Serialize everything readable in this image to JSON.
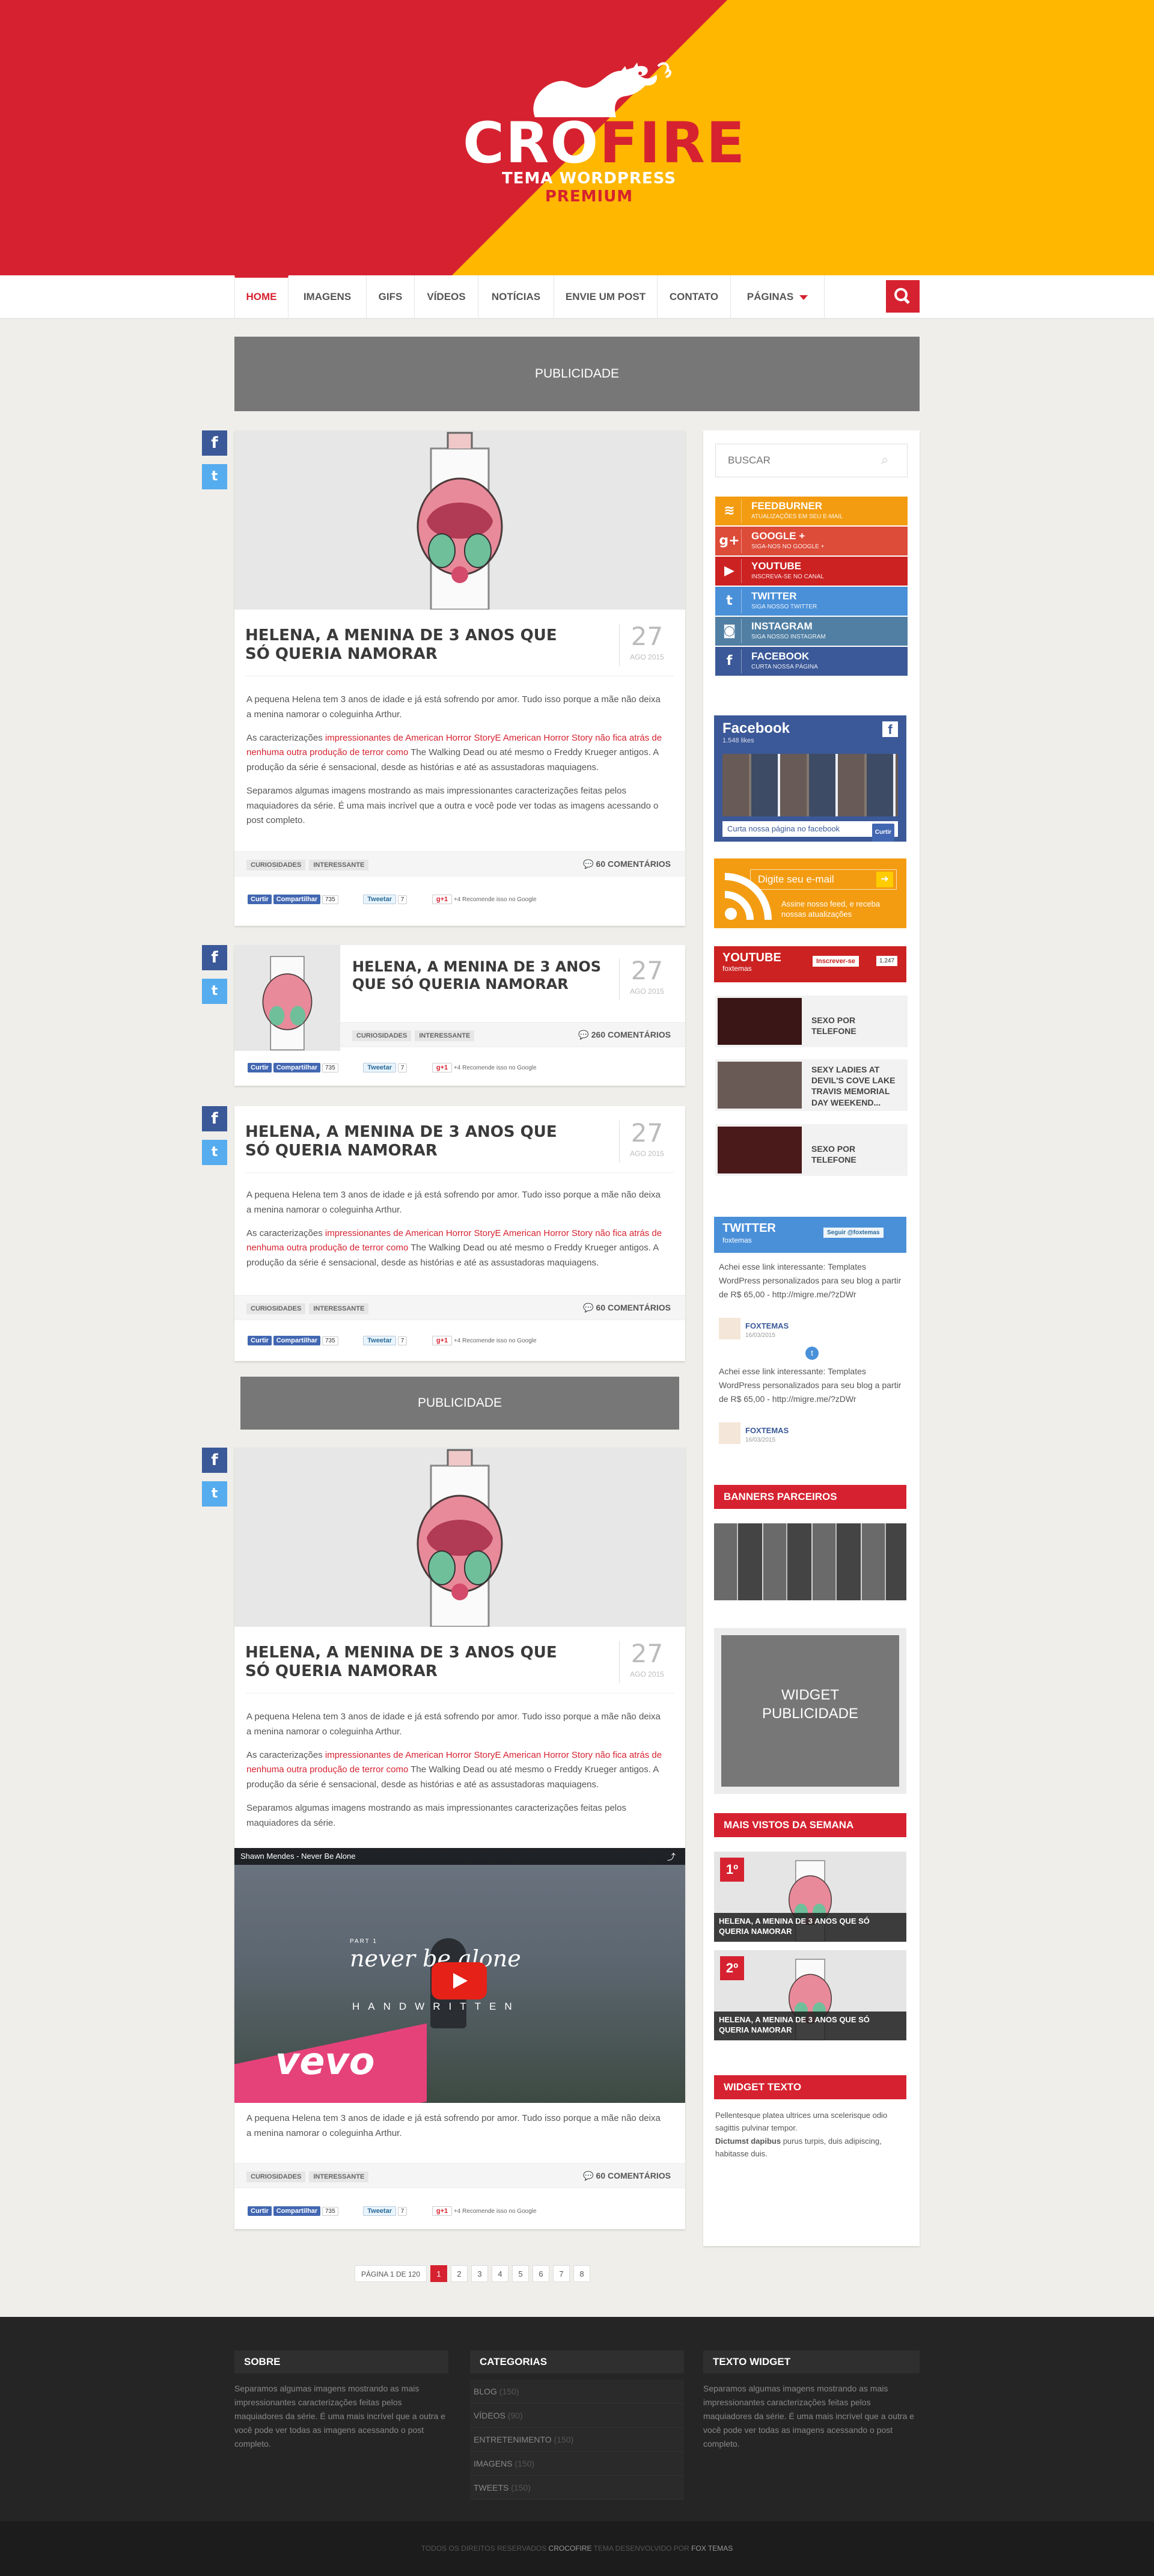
{
  "brand": {
    "logo_main_1": "CRO",
    "logo_main_2": "FIRE",
    "logo_sub_1": "TEMA WORDPRESS ",
    "logo_sub_2": "PREMIUM",
    "colors": {
      "red": "#d62230",
      "yellow": "#ffb700"
    }
  },
  "nav": {
    "items": [
      {
        "label": "HOME"
      },
      {
        "label": "IMAGENS"
      },
      {
        "label": "GIFS"
      },
      {
        "label": "VÍDEOS"
      },
      {
        "label": "NOTÍCIAS"
      },
      {
        "label": "ENVIE UM POST"
      },
      {
        "label": "CONTATO"
      },
      {
        "label": "PÁGINAS"
      }
    ],
    "search_icon": "search-icon"
  },
  "ads": {
    "top": "PUBLICIDADE",
    "mid": "PUBLICIDADE"
  },
  "posts": [
    {
      "title": "HELENA, A MENINA DE 3 ANOS QUE SÓ QUERIA NAMORAR",
      "day": "27",
      "month": "AGO 2015",
      "p1": "A pequena Helena tem 3 anos de idade e já está sofrendo por amor. Tudo isso porque a mãe não deixa a menina namorar o coleguinha Arthur.",
      "p2_pre": "As caracterizações ",
      "p2_link": "impressionantes de American Horror StoryE American Horror Story não fica atrás de nenhuma outra produção de terror como",
      "p2_post": " The Walking Dead ou até mesmo o Freddy Krueger antigos. A produção da série é sensacional, desde as histórias e até as assustadoras maquiagens.",
      "p3": "Separamos algumas imagens mostrando as mais impressionantes caracterizações feitas pelos maquiadores da série. É uma mais incrível que a outra e você pode ver todas as imagens acessando o post completo.",
      "tags": [
        "CURIOSIDADES",
        "INTERESSANTE"
      ],
      "comments": "60 COMENTÁRIOS"
    },
    {
      "title": "HELENA, A MENINA DE 3 ANOS QUE SÓ QUERIA NAMORAR",
      "day": "27",
      "month": "AGO 2015",
      "tags": [
        "CURIOSIDADES",
        "INTERESSANTE"
      ],
      "comments": "260 COMENTÁRIOS"
    },
    {
      "title": "HELENA, A MENINA DE 3 ANOS QUE SÓ QUERIA NAMORAR",
      "day": "27",
      "month": "AGO 2015",
      "p1": "A pequena Helena tem 3 anos de idade e já está sofrendo por amor. Tudo isso porque a mãe não deixa a menina namorar o coleguinha Arthur.",
      "p2_pre": "As caracterizações ",
      "p2_link": "impressionantes de American Horror StoryE American Horror Story não fica atrás de nenhuma outra produção de terror como",
      "p2_post": " The Walking Dead ou até mesmo o Freddy Krueger antigos. A produção da série é sensacional, desde as histórias e até as assustadoras maquiagens.",
      "tags": [
        "CURIOSIDADES",
        "INTERESSANTE"
      ],
      "comments": "60 COMENTÁRIOS"
    },
    {
      "title": "HELENA, A MENINA DE 3 ANOS QUE SÓ QUERIA NAMORAR",
      "day": "27",
      "month": "AGO 2015",
      "p1": "A pequena Helena tem 3 anos de idade e já está sofrendo por amor. Tudo isso porque a mãe não deixa a menina namorar o coleguinha Arthur.",
      "p2_pre": "As caracterizações ",
      "p2_link": "impressionantes de American Horror StoryE American Horror Story não fica atrás de nenhuma outra produção de terror como",
      "p2_post": " The Walking Dead ou até mesmo o Freddy Krueger antigos. A produção da série é sensacional, desde as histórias e até as assustadoras maquiagens.",
      "p3": "Separamos algumas imagens mostrando as mais impressionantes caracterizações feitas pelos maquiadores da série.",
      "video_title": "Shawn Mendes - Never Be Alone",
      "video_part": "PART 1",
      "video_script": "never be alone",
      "video_hand": "HANDWRITTEN",
      "video_brand": "vevo",
      "p4": "A pequena Helena tem 3 anos de idade e já está sofrendo por amor. Tudo isso porque a mãe não deixa a menina namorar o coleguinha Arthur.",
      "tags": [
        "CURIOSIDADES",
        "INTERESSANTE"
      ],
      "comments": "60 COMENTÁRIOS"
    }
  ],
  "social_buttons": {
    "fb_like": "Curtir",
    "fb_share": "Compartilhar",
    "fb_count": "735",
    "tw": "Tweetar",
    "tw_count": "7",
    "gp": "g+1",
    "gp_count": "+4",
    "gp_text": "Recomende isso no Google"
  },
  "sidebar": {
    "search_placeholder": "BUSCAR",
    "networks": [
      {
        "name": "FEEDBURNER",
        "sub": "ATUALIZAÇÕES EM SEU E-MAIL",
        "color": "#f39c12",
        "icon": "rss-icon",
        "glyph": "≋"
      },
      {
        "name": "GOOGLE +",
        "sub": "SIGA-NOS NO GOOGLE +",
        "color": "#dd4b39",
        "icon": "googleplus-icon",
        "glyph": "g+"
      },
      {
        "name": "YOUTUBE",
        "sub": "INSCREVA-SE NO CANAL",
        "color": "#cc2222",
        "icon": "youtube-icon",
        "glyph": "▶"
      },
      {
        "name": "TWITTER",
        "sub": "SIGA NOSSO TWITTER",
        "color": "#4a90d9",
        "icon": "twitter-icon",
        "glyph": "t"
      },
      {
        "name": "INSTAGRAM",
        "sub": "SIGA NOSSO INSTAGRAM",
        "color": "#517fa4",
        "icon": "instagram-icon",
        "glyph": "◙"
      },
      {
        "name": "FACEBOOK",
        "sub": "CURTA NOSSA PÁGINA",
        "color": "#3b5998",
        "icon": "facebook-icon",
        "glyph": "f"
      }
    ],
    "fb_box": {
      "title": "Facebook",
      "likes": "1.548 likes",
      "footer": "Curta nossa página no facebook",
      "btn": "Curtir"
    },
    "newsletter": {
      "placeholder": "Digite seu e-mail",
      "text": "Assine nosso feed, e receba nossas atualizações"
    },
    "youtube": {
      "title": "YOUTUBE",
      "sub": "foxtemas",
      "btn": "Inscrever-se",
      "count": "1.247",
      "videos": [
        "SEXO POR TELEFONE",
        "SEXY LADIES AT DEVIL'S COVE LAKE TRAVIS MEMORIAL DAY WEEKEND...",
        "SEXO POR TELEFONE"
      ]
    },
    "twitter": {
      "title": "TWITTER",
      "sub": "foxtemas",
      "btn": "Seguir @foxtemas",
      "tweet": "Achei esse link interessante: Templates WordPress personalizados para seu blog a partir de R$ 65,00 - http://migre.me/?zDWr",
      "user": "FOXTEMAS",
      "date": "16/03/2015"
    },
    "banners_title": "BANNERS PARCEIROS",
    "widget_ad": "WIDGET PUBLICIDADE",
    "most_viewed": {
      "title": "MAIS VISTOS DA SEMANA",
      "items": [
        {
          "rank": "1º",
          "title": "HELENA, A MENINA DE 3 ANOS QUE SÓ QUERIA NAMORAR"
        },
        {
          "rank": "2º",
          "title": "HELENA, A MENINA DE 3 ANOS QUE SÓ QUERIA NAMORAR"
        }
      ]
    },
    "text_widget": {
      "title": "WIDGET TEXTO",
      "line1": "Pellentesque platea ultrices urna scelerisque odio sagittis pulvinar tempor.",
      "bold": "Dictumst dapibus",
      "line2": " purus turpis, duis adipiscing, habitasse duis."
    }
  },
  "pagination": {
    "label": "PÁGINA 1 DE 120",
    "pages": [
      "1",
      "2",
      "3",
      "4",
      "5",
      "6",
      "7",
      "8"
    ]
  },
  "footer": {
    "sobre": {
      "title": "SOBRE",
      "text": "Separamos algumas imagens mostrando as mais impressionantes caracterizações feitas pelos maquiadores da série. É uma mais incrível que a outra e você pode ver todas as imagens acessando o post completo."
    },
    "categorias": {
      "title": "CATEGORIAS",
      "items": [
        {
          "name": "BLOG",
          "count": "(150)"
        },
        {
          "name": "VÍDEOS",
          "count": "(90)"
        },
        {
          "name": "ENTRETENIMENTO",
          "count": "(150)"
        },
        {
          "name": "IMAGENS",
          "count": "(150)"
        },
        {
          "name": "TWEETS",
          "count": "(150)"
        }
      ]
    },
    "widget": {
      "title": "TEXTO WIDGET",
      "text": "Separamos algumas imagens mostrando as mais impressionantes caracterizações feitas pelos maquiadores da série. É uma mais incrível que a outra e você pode ver todas as imagens acessando o post completo."
    },
    "copy_pre": "TODOS OS DIREITOS RESERVADOS ",
    "copy_brand": "CROCOFIRE",
    "copy_mid": " TEMA DESENVOLVIDO POR ",
    "copy_author": "FOX TEMAS"
  }
}
